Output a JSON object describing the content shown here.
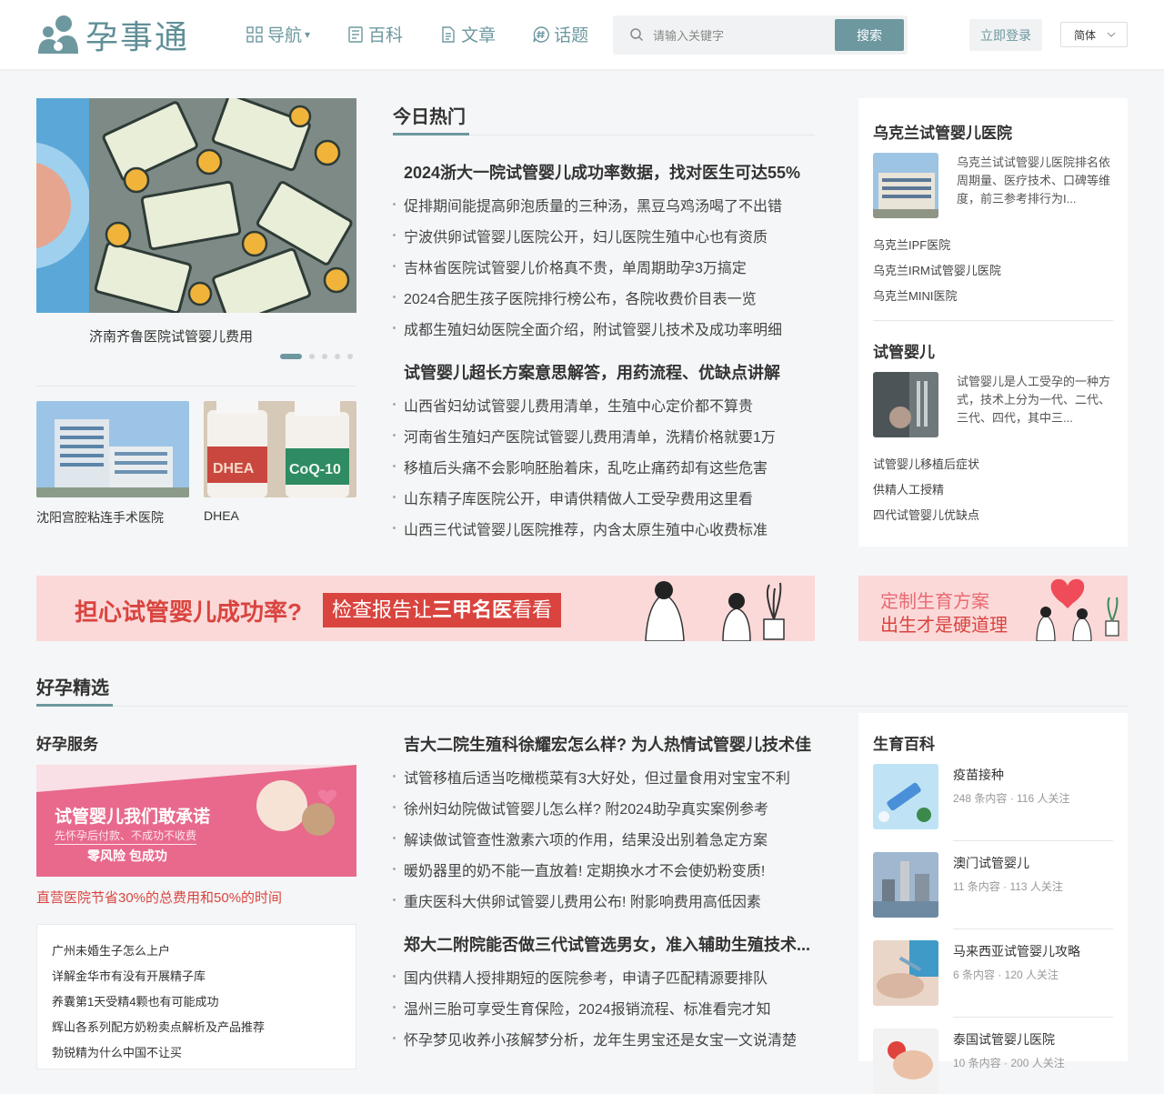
{
  "header": {
    "logo_text": "孕事通",
    "nav": [
      {
        "label": "导航",
        "caret": "▾"
      },
      {
        "label": "百科"
      },
      {
        "label": "文章"
      },
      {
        "label": "话题"
      }
    ],
    "search_placeholder": "请输入关键字",
    "search_button": "搜索",
    "login_button": "立即登录",
    "language": "简体"
  },
  "carousel": {
    "caption": "济南齐鲁医院试管婴儿费用",
    "slide_count": 5,
    "active_index": 0
  },
  "thumbs": [
    {
      "caption": "沈阳宫腔粘连手术医院"
    },
    {
      "caption": "DHEA",
      "bottle1": "DHEA",
      "bottle2": "CoQ-10"
    }
  ],
  "hot": {
    "title": "今日热门",
    "groups": [
      {
        "headline": "2024浙大一院试管婴儿成功率数据，找对医生可达55%",
        "items": [
          "促排期间能提高卵泡质量的三种汤，黑豆乌鸡汤喝了不出错",
          "宁波供卵试管婴儿医院公开，妇儿医院生殖中心也有资质",
          "吉林省医院试管婴儿价格真不贵，单周期助孕3万搞定",
          "2024合肥生孩子医院排行榜公布，各院收费价目表一览",
          "成都生殖妇幼医院全面介绍，附试管婴儿技术及成功率明细"
        ]
      },
      {
        "headline": "试管婴儿超长方案意思解答，用药流程、优缺点讲解",
        "items": [
          "山西省妇幼试管婴儿费用清单，生殖中心定价都不算贵",
          "河南省生殖妇产医院试管婴儿费用清单，洗精价格就要1万",
          "移植后头痛不会影响胚胎着床，乱吃止痛药却有这些危害",
          "山东精子库医院公开，申请供精做人工受孕费用这里看",
          "山西三代试管婴儿医院推荐，内含太原生殖中心收费标准"
        ]
      }
    ]
  },
  "side_cards": [
    {
      "title": "乌克兰试管婴儿医院",
      "desc": "乌克兰试试管婴儿医院排名依周期量、医疗技术、口碑等维度，前三参考排行为I...",
      "links": [
        "乌克兰IPF医院",
        "乌克兰IRM试管婴儿医院",
        "乌克兰MINI医院"
      ]
    },
    {
      "title": "试管婴儿",
      "desc": "试管婴儿是人工受孕的一种方式，技术上分为一代、二代、三代、四代，其中三...",
      "links": [
        "试管婴儿移植后症状",
        "供精人工授精",
        "四代试管婴儿优缺点"
      ]
    }
  ],
  "banner_main": {
    "text1": "担心试管婴儿成功率?",
    "text2_a": "检查报告让",
    "text2_b": "三甲名医",
    "text2_c": "看看"
  },
  "banner_side": {
    "line1": "定制生育方案",
    "line2": "出生才是硬道理"
  },
  "featured": {
    "title": "好孕精选",
    "service_title": "好孕服务",
    "service_banner": {
      "line1": "试管婴儿我们敢承诺",
      "line2": "先怀孕后付款、不成功不收费",
      "line3": "零风险 包成功"
    },
    "service_red": "直营医院节省30%的总费用和50%的时间",
    "service_list": [
      "广州未婚生子怎么上户",
      "详解金华市有没有开展精子库",
      "养囊第1天受精4颗也有可能成功",
      "辉山各系列配方奶粉卖点解析及产品推荐",
      "勃锐精为什么中国不让买"
    ],
    "news_groups": [
      {
        "headline": "吉大二院生殖科徐耀宏怎么样? 为人热情试管婴儿技术佳",
        "items": [
          "试管移植后适当吃橄榄菜有3大好处，但过量食用对宝宝不利",
          "徐州妇幼院做试管婴儿怎么样? 附2024助孕真实案例参考",
          "解读做试管查性激素六项的作用，结果没出别着急定方案",
          "暖奶器里的奶不能一直放着! 定期换水才不会使奶粉变质!",
          "重庆医科大供卵试管婴儿费用公布! 附影响费用高低因素"
        ]
      },
      {
        "headline": "郑大二附院能否做三代试管选男女，准入辅助生殖技术...",
        "items": [
          "国内供精人授排期短的医院参考，申请子匹配精源要排队",
          "温州三胎可享受生育保险，2024报销流程、标准看完才知",
          "怀孕梦见收养小孩解梦分析，龙年生男宝还是女宝一文说清楚"
        ]
      }
    ],
    "ency_title": "生育百科",
    "ency": [
      {
        "title": "疫苗接种",
        "meta": "248 条内容 · 116 人关注"
      },
      {
        "title": "澳门试管婴儿",
        "meta": "11 条内容 · 113 人关注"
      },
      {
        "title": "马来西亚试管婴儿攻略",
        "meta": "6 条内容 · 120 人关注"
      },
      {
        "title": "泰国试管婴儿医院",
        "meta": "10 条内容 · 200 人关注"
      }
    ]
  }
}
